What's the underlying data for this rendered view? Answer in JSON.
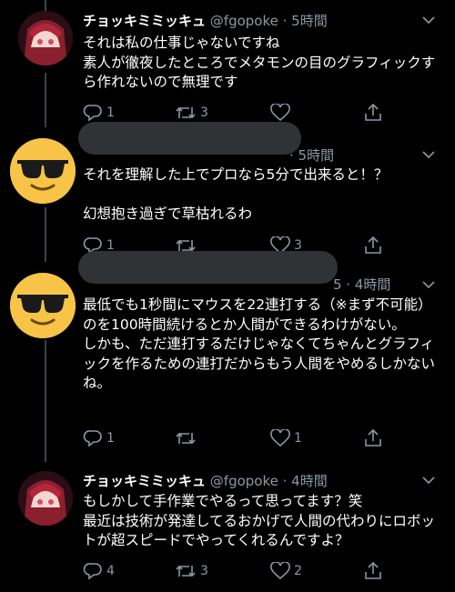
{
  "tweets": [
    {
      "name": "チョッキミミッキュ",
      "handle": "@fgopoke",
      "time": "· 5時間",
      "body": "それは私の仕事じゃないですね\n素人が徹夜したところでメタモンの目のグラフィックすら作れないので無理です",
      "replies": "1",
      "retweets": "3",
      "likes": ""
    },
    {
      "name": "",
      "handle": "",
      "time": "· 5時間",
      "body": "それを理解した上でプロなら5分で出来ると！？\n\n幻想抱き過ぎで草枯れるわ",
      "replies": "1",
      "retweets": "",
      "likes": "3"
    },
    {
      "name": "",
      "handle": "",
      "time": "5 · 4時間",
      "body": "最低でも1秒間にマウスを22連打する（※まず不可能）のを100時間続けるとか人間ができるわけがない。\nしかも、ただ連打するだけじゃなくてちゃんとグラフィックを作るための連打だからもう人間をやめるしかないね。",
      "replies": "1",
      "retweets": "",
      "likes": "1"
    },
    {
      "name": "チョッキミミッキュ",
      "handle": "@fgopoke",
      "time": "· 4時間",
      "body": "もしかして手作業でやるって思ってます？笑\n最近は技術が発達してるおかげで人間の代わりにロボットが超スピードでやってくれるんですよ？",
      "replies": "4",
      "retweets": "3",
      "likes": "2"
    }
  ],
  "icons": {
    "reply": "reply-icon",
    "retweet": "retweet-icon",
    "like": "heart-icon",
    "share": "share-icon",
    "more": "chevron-down-icon"
  },
  "colors": {
    "background": "#000000",
    "text": "#ffffff",
    "muted": "#8899a6",
    "thread_line": "#38444d",
    "redaction": "#2f3336",
    "emoji": "#f7c447"
  }
}
